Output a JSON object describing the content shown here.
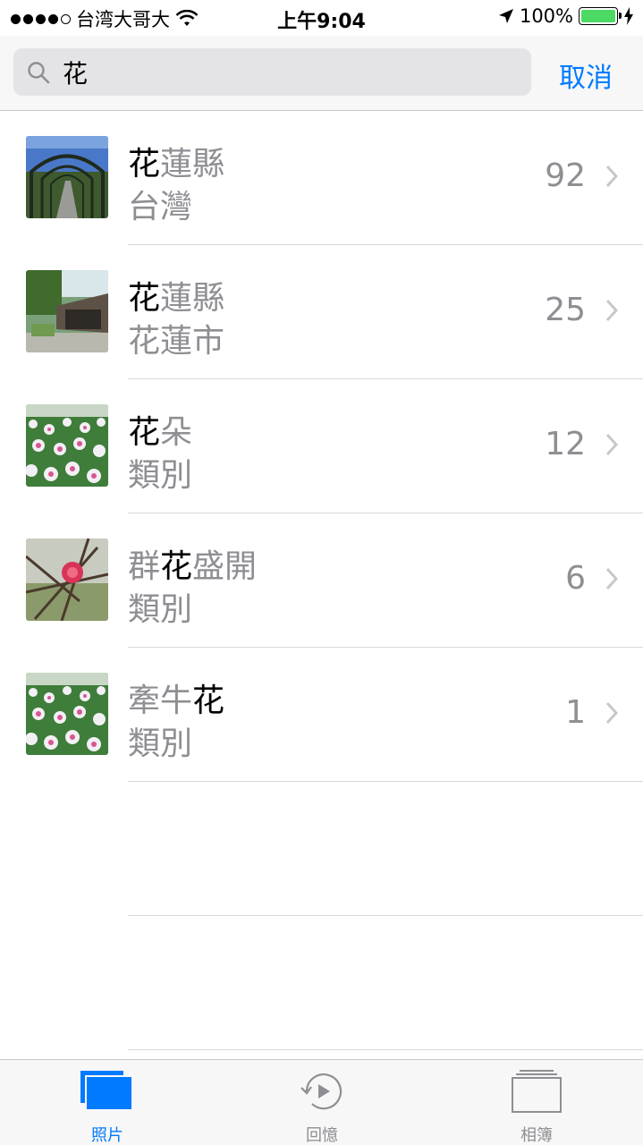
{
  "status_bar": {
    "carrier": "台湾大哥大",
    "time": "上午9:04",
    "battery_percent": "100%"
  },
  "search": {
    "query": "花",
    "cancel_label": "取消"
  },
  "results": [
    {
      "highlight_prefix": "",
      "highlight": "花",
      "highlight_suffix": "蓮縣",
      "subtitle": "台灣",
      "count": "92"
    },
    {
      "highlight_prefix": "",
      "highlight": "花",
      "highlight_suffix": "蓮縣",
      "subtitle": "花蓮市",
      "count": "25"
    },
    {
      "highlight_prefix": "",
      "highlight": "花",
      "highlight_suffix": "朵",
      "subtitle": "類別",
      "count": "12"
    },
    {
      "highlight_prefix": "群",
      "highlight": "花",
      "highlight_suffix": "盛開",
      "subtitle": "類別",
      "count": "6"
    },
    {
      "highlight_prefix": "牽牛",
      "highlight": "花",
      "highlight_suffix": "",
      "subtitle": "類別",
      "count": "1"
    }
  ],
  "tabs": [
    {
      "label": "照片",
      "icon": "photos-icon",
      "active": true
    },
    {
      "label": "回憶",
      "icon": "memories-icon",
      "active": false
    },
    {
      "label": "相簿",
      "icon": "albums-icon",
      "active": false
    }
  ],
  "colors": {
    "accent": "#007aff",
    "secondary_text": "#8e8e93",
    "battery": "#4cd964"
  }
}
